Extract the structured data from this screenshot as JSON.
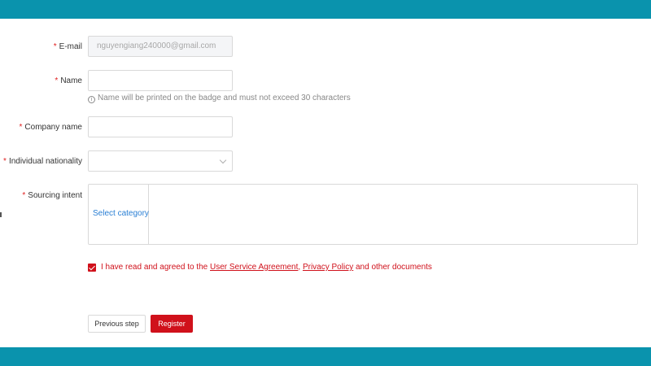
{
  "form": {
    "email": {
      "label": "E-mail",
      "value": "nguyengiang240000@gmail.com"
    },
    "name": {
      "label": "Name",
      "value": "",
      "hint": "Name will be printed on the badge and must not exceed 30 characters"
    },
    "company": {
      "label": "Company name",
      "value": ""
    },
    "nationality": {
      "label": "Individual nationality",
      "value": ""
    },
    "sourcing": {
      "label": "Sourcing intent",
      "select_label": "Select category"
    },
    "required_mark": "*"
  },
  "agreement": {
    "checked": true,
    "prefix": "I have read and agreed to the ",
    "link1": "User Service Agreement",
    "sep": ", ",
    "link2": "Privacy Policy",
    "suffix": " and other documents"
  },
  "buttons": {
    "previous": "Previous step",
    "register": "Register"
  },
  "colors": {
    "header": "#0a93ad",
    "accent": "#d0111b",
    "link": "#2a7fd4"
  },
  "icons": {
    "hint": "info-circle-icon",
    "dropdown": "chevron-down-icon",
    "checkbox": "checkbox-checked-icon"
  }
}
